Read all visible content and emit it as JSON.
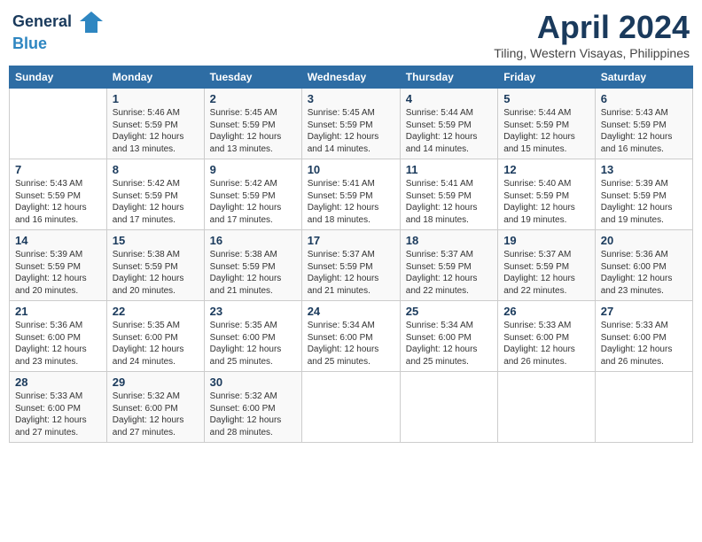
{
  "header": {
    "logo_line1": "General",
    "logo_line2": "Blue",
    "month": "April 2024",
    "location": "Tiling, Western Visayas, Philippines"
  },
  "weekdays": [
    "Sunday",
    "Monday",
    "Tuesday",
    "Wednesday",
    "Thursday",
    "Friday",
    "Saturday"
  ],
  "weeks": [
    [
      {
        "day": "",
        "sunrise": "",
        "sunset": "",
        "daylight": ""
      },
      {
        "day": "1",
        "sunrise": "5:46 AM",
        "sunset": "5:59 PM",
        "daylight": "12 hours and 13 minutes."
      },
      {
        "day": "2",
        "sunrise": "5:45 AM",
        "sunset": "5:59 PM",
        "daylight": "12 hours and 13 minutes."
      },
      {
        "day": "3",
        "sunrise": "5:45 AM",
        "sunset": "5:59 PM",
        "daylight": "12 hours and 14 minutes."
      },
      {
        "day": "4",
        "sunrise": "5:44 AM",
        "sunset": "5:59 PM",
        "daylight": "12 hours and 14 minutes."
      },
      {
        "day": "5",
        "sunrise": "5:44 AM",
        "sunset": "5:59 PM",
        "daylight": "12 hours and 15 minutes."
      },
      {
        "day": "6",
        "sunrise": "5:43 AM",
        "sunset": "5:59 PM",
        "daylight": "12 hours and 16 minutes."
      }
    ],
    [
      {
        "day": "7",
        "sunrise": "5:43 AM",
        "sunset": "5:59 PM",
        "daylight": "12 hours and 16 minutes."
      },
      {
        "day": "8",
        "sunrise": "5:42 AM",
        "sunset": "5:59 PM",
        "daylight": "12 hours and 17 minutes."
      },
      {
        "day": "9",
        "sunrise": "5:42 AM",
        "sunset": "5:59 PM",
        "daylight": "12 hours and 17 minutes."
      },
      {
        "day": "10",
        "sunrise": "5:41 AM",
        "sunset": "5:59 PM",
        "daylight": "12 hours and 18 minutes."
      },
      {
        "day": "11",
        "sunrise": "5:41 AM",
        "sunset": "5:59 PM",
        "daylight": "12 hours and 18 minutes."
      },
      {
        "day": "12",
        "sunrise": "5:40 AM",
        "sunset": "5:59 PM",
        "daylight": "12 hours and 19 minutes."
      },
      {
        "day": "13",
        "sunrise": "5:39 AM",
        "sunset": "5:59 PM",
        "daylight": "12 hours and 19 minutes."
      }
    ],
    [
      {
        "day": "14",
        "sunrise": "5:39 AM",
        "sunset": "5:59 PM",
        "daylight": "12 hours and 20 minutes."
      },
      {
        "day": "15",
        "sunrise": "5:38 AM",
        "sunset": "5:59 PM",
        "daylight": "12 hours and 20 minutes."
      },
      {
        "day": "16",
        "sunrise": "5:38 AM",
        "sunset": "5:59 PM",
        "daylight": "12 hours and 21 minutes."
      },
      {
        "day": "17",
        "sunrise": "5:37 AM",
        "sunset": "5:59 PM",
        "daylight": "12 hours and 21 minutes."
      },
      {
        "day": "18",
        "sunrise": "5:37 AM",
        "sunset": "5:59 PM",
        "daylight": "12 hours and 22 minutes."
      },
      {
        "day": "19",
        "sunrise": "5:37 AM",
        "sunset": "5:59 PM",
        "daylight": "12 hours and 22 minutes."
      },
      {
        "day": "20",
        "sunrise": "5:36 AM",
        "sunset": "6:00 PM",
        "daylight": "12 hours and 23 minutes."
      }
    ],
    [
      {
        "day": "21",
        "sunrise": "5:36 AM",
        "sunset": "6:00 PM",
        "daylight": "12 hours and 23 minutes."
      },
      {
        "day": "22",
        "sunrise": "5:35 AM",
        "sunset": "6:00 PM",
        "daylight": "12 hours and 24 minutes."
      },
      {
        "day": "23",
        "sunrise": "5:35 AM",
        "sunset": "6:00 PM",
        "daylight": "12 hours and 25 minutes."
      },
      {
        "day": "24",
        "sunrise": "5:34 AM",
        "sunset": "6:00 PM",
        "daylight": "12 hours and 25 minutes."
      },
      {
        "day": "25",
        "sunrise": "5:34 AM",
        "sunset": "6:00 PM",
        "daylight": "12 hours and 25 minutes."
      },
      {
        "day": "26",
        "sunrise": "5:33 AM",
        "sunset": "6:00 PM",
        "daylight": "12 hours and 26 minutes."
      },
      {
        "day": "27",
        "sunrise": "5:33 AM",
        "sunset": "6:00 PM",
        "daylight": "12 hours and 26 minutes."
      }
    ],
    [
      {
        "day": "28",
        "sunrise": "5:33 AM",
        "sunset": "6:00 PM",
        "daylight": "12 hours and 27 minutes."
      },
      {
        "day": "29",
        "sunrise": "5:32 AM",
        "sunset": "6:00 PM",
        "daylight": "12 hours and 27 minutes."
      },
      {
        "day": "30",
        "sunrise": "5:32 AM",
        "sunset": "6:00 PM",
        "daylight": "12 hours and 28 minutes."
      },
      {
        "day": "",
        "sunrise": "",
        "sunset": "",
        "daylight": ""
      },
      {
        "day": "",
        "sunrise": "",
        "sunset": "",
        "daylight": ""
      },
      {
        "day": "",
        "sunrise": "",
        "sunset": "",
        "daylight": ""
      },
      {
        "day": "",
        "sunrise": "",
        "sunset": "",
        "daylight": ""
      }
    ]
  ],
  "labels": {
    "sunrise": "Sunrise:",
    "sunset": "Sunset:",
    "daylight": "Daylight:"
  }
}
